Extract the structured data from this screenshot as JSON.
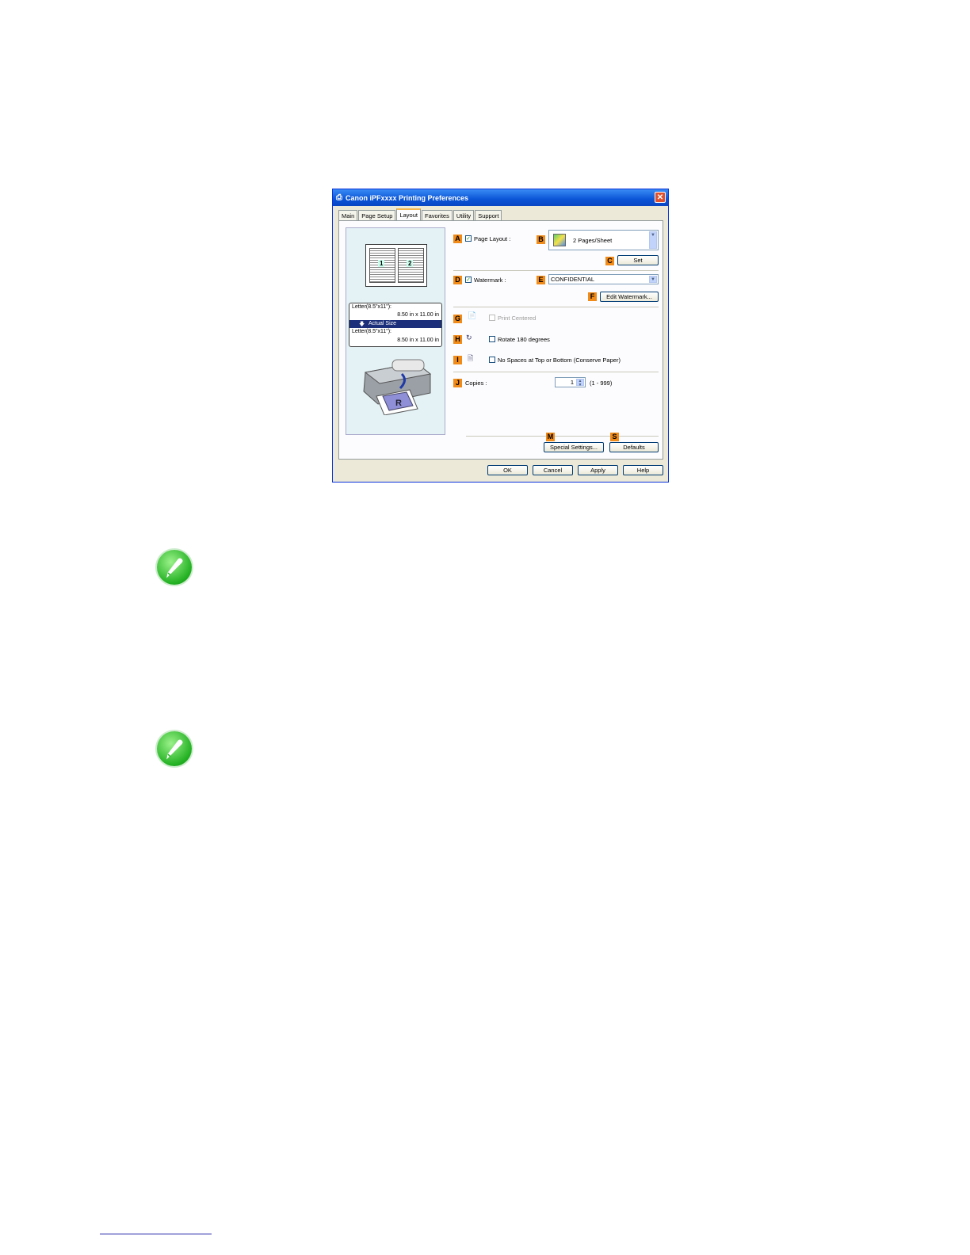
{
  "dialog": {
    "title": "Canon iPFxxxx Printing Preferences",
    "close": "✕",
    "tabs": [
      {
        "label": "Main"
      },
      {
        "label": "Page Setup"
      },
      {
        "label": "Layout"
      },
      {
        "label": "Favorites"
      },
      {
        "label": "Utility"
      },
      {
        "label": "Support"
      }
    ],
    "active_tab": "Layout"
  },
  "preview": {
    "page_numbers": [
      "1",
      "2"
    ],
    "size_line1": "Letter(8.5\"x11\"):",
    "size_line2": "8.50 in x 11.00 in",
    "actual_size": "Actual Size",
    "size_line3": "Letter(8.5\"x11\"):",
    "size_line4": "8.50 in x 11.00 in"
  },
  "labels": {
    "A": "A",
    "B": "B",
    "C": "C",
    "D": "D",
    "E": "E",
    "F": "F",
    "G": "G",
    "H": "H",
    "I": "I",
    "J": "J",
    "M": "M",
    "S": "S"
  },
  "layout": {
    "page_layout_label": "Page Layout :",
    "page_layout_checked": true,
    "pages_value": "2 Pages/Sheet",
    "set_button": "Set",
    "watermark_label": "Watermark :",
    "watermark_checked": true,
    "watermark_value": "CONFIDENTIAL",
    "edit_watermark_button": "Edit Watermark...",
    "print_centered_label": "Print Centered",
    "rotate_label": "Rotate 180 degrees",
    "no_spaces_label": "No Spaces at Top or Bottom (Conserve Paper)",
    "copies_label": "Copies :",
    "copies_value": "1",
    "copies_range": "(1 - 999)",
    "special_settings_button": "Special Settings...",
    "defaults_button": "Defaults"
  },
  "footer_buttons": {
    "ok": "OK",
    "cancel": "Cancel",
    "apply": "Apply",
    "help": "Help"
  },
  "colors": {
    "label_orange": "#f08a18",
    "title_blue": "#0a54d6",
    "note_green": "#22b022"
  },
  "icons": [
    "printer-settings-icon",
    "note-pencil-icon"
  ]
}
